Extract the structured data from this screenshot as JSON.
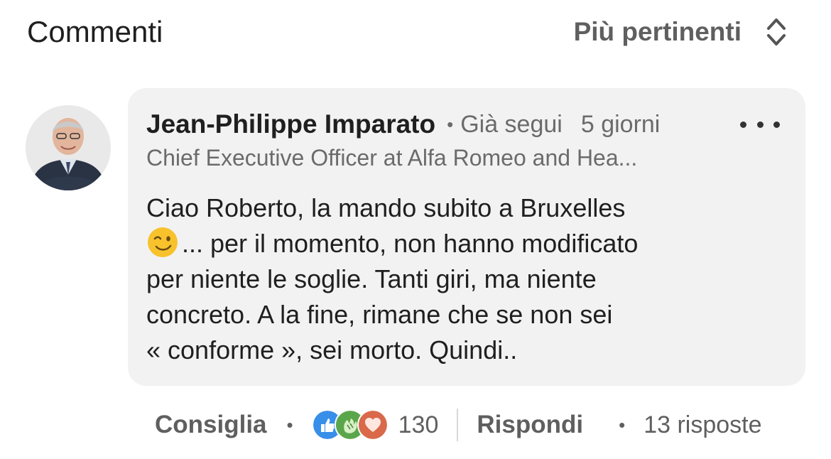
{
  "header": {
    "title": "Commenti",
    "sort_label": "Più pertinenti",
    "sort_icon": "sort-updown-icon"
  },
  "comment": {
    "author": "Jean-Philippe Imparato",
    "follow_status": "Già segui",
    "time": "5 giorni",
    "headline": "Chief Executive Officer at Alfa Romeo and Hea...",
    "text_line1": "Ciao Roberto, la mando subito a Bruxelles",
    "emoji": "winking-face-emoji",
    "text_line2": "... per il momento, non hanno modificato",
    "text_line3": "per niente le soglie. Tanti giri, ma niente",
    "text_line4": "concreto. A la fine, rimane che se non sei",
    "text_line5": "« conforme », sei morto. Quindi..",
    "avatar_icon": "profile-photo"
  },
  "actions": {
    "like_label": "Consiglia",
    "reaction_icons": [
      "like-reaction-icon",
      "celebrate-reaction-icon",
      "love-reaction-icon"
    ],
    "reaction_count": "130",
    "reply_label": "Rispondi",
    "replies_label": "13 risposte"
  },
  "colors": {
    "bubble_bg": "#f2f2f2",
    "like_blue": "#378fe9",
    "celebrate_green": "#5aa64a",
    "love_orange": "#d9694a"
  }
}
